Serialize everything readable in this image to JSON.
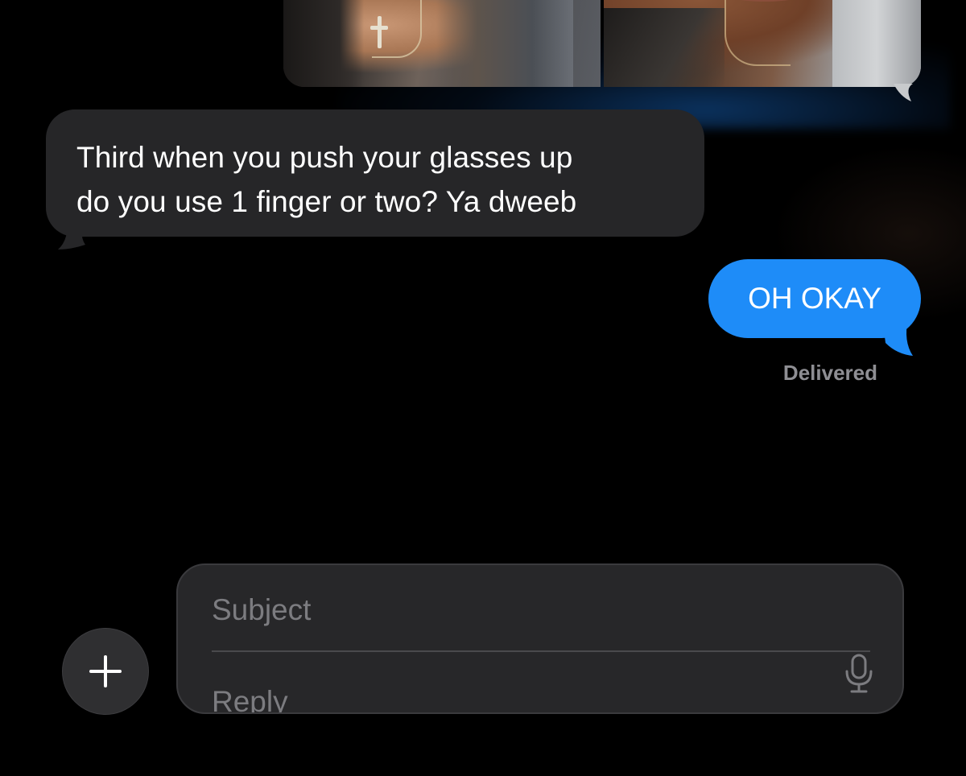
{
  "thread": {
    "attachment": {
      "icons": [
        "photo-left",
        "photo-right"
      ]
    },
    "messages": [
      {
        "direction": "incoming",
        "lines": [
          "Third when you push your glasses up",
          "do you use 1 finger or two? Ya dweeb"
        ]
      },
      {
        "direction": "outgoing",
        "text": "OH OKAY",
        "status": "Delivered"
      }
    ]
  },
  "compose": {
    "add_icon": "plus-icon",
    "subject_placeholder": "Subject",
    "reply_placeholder": "Reply",
    "mic_icon": "microphone-icon"
  },
  "colors": {
    "background": "#000000",
    "incoming_bubble": "#262628",
    "outgoing_bubble": "#1e8cf8",
    "status_text": "#8e8e93",
    "compose_bg": "#272729"
  }
}
